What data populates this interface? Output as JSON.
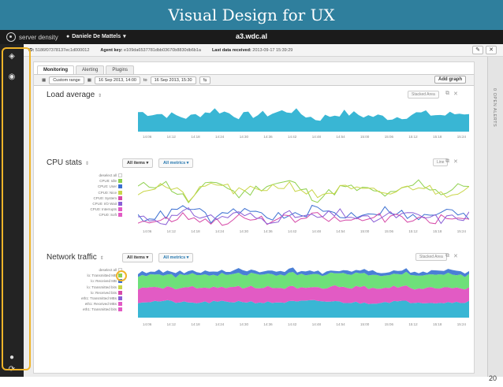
{
  "slide": {
    "title": "Visual Design for UX",
    "page_number": "20"
  },
  "colors": {
    "banner": "#2f7f9d",
    "highlight": "#f0b429",
    "chart_blue": "#39b6d4"
  },
  "app": {
    "logo_text": "server density",
    "user_name": "Daniele De Mattels",
    "host": "a3.wdc.al",
    "info": {
      "id_label": "ID:",
      "id_value": "5186f07378137ec1d000012",
      "agent_label": "Agent key:",
      "agent_value": "e109da6537781dbb03670b8830db6b1a",
      "last_label": "Last data received:",
      "last_value": "2013-09-17 15:39:29"
    },
    "tools": {
      "edit": "✎",
      "close": "✕"
    },
    "sidebar_icons": [
      "layers-icon",
      "globe-icon",
      "chat-icon",
      "settings-icon"
    ]
  },
  "tabs": [
    {
      "label": "Monitoring"
    },
    {
      "label": "Alerting"
    },
    {
      "label": "Plugins"
    }
  ],
  "controls": {
    "range": "Custom range",
    "from": "16 Sep 2013, 14:00",
    "to_label": "to",
    "to": "16 Sep 2013, 15:30",
    "add_graph": "Add graph"
  },
  "alerts": {
    "label": "0 OPEN ALERTS"
  },
  "xticks": [
    "14:06",
    "14:12",
    "14:18",
    "14:24",
    "14:30",
    "14:36",
    "14:42",
    "14:48",
    "14:54",
    "15:00",
    "15:06",
    "15:12",
    "15:18",
    "15:24"
  ],
  "sections": {
    "load": {
      "title": "Load average",
      "type": "Stacked Area"
    },
    "cpu": {
      "title": "CPU stats",
      "items": "All items",
      "metrics": "All metrics",
      "type": "Line",
      "legend": [
        "deselect all",
        "CPU0: Idle",
        "CPU0: User",
        "CPU0: Nice",
        "CPU0: System",
        "CPU0: I/O Wait",
        "CPU0: Interrupts",
        "CPU0: Soft"
      ]
    },
    "net": {
      "title": "Network traffic",
      "items": "All items",
      "metrics": "All metrics",
      "type": "Stacked Area",
      "legend": [
        "deselect all",
        "lo: Transmitted MB",
        "lo: Received MB",
        "lo: Transmitted bits",
        "lo: Received bits",
        "eth1: Transmitted MBs",
        "eth1: Received MBs",
        "eth1: Transmitted bits"
      ]
    }
  },
  "chart_data": [
    {
      "type": "area",
      "title": "Load average",
      "x": [
        "14:06",
        "14:12",
        "14:18",
        "14:24",
        "14:30",
        "14:36",
        "14:42",
        "14:48",
        "14:54",
        "15:00",
        "15:06",
        "15:12",
        "15:18",
        "15:24"
      ],
      "series": [
        {
          "values": [
            0.62,
            0.55,
            0.45,
            0.7,
            0.5,
            0.55,
            0.68,
            0.4,
            0.6,
            0.5,
            0.45,
            0.58,
            0.52,
            0.62
          ]
        }
      ],
      "color": "#39b6d4"
    },
    {
      "type": "line",
      "title": "CPU stats",
      "x": [
        "14:06",
        "14:12",
        "14:18",
        "14:24",
        "14:30",
        "14:36",
        "14:42",
        "14:48",
        "14:54",
        "15:00",
        "15:06",
        "15:12",
        "15:18",
        "15:24"
      ],
      "series": [
        {
          "name": "CPU0: Idle",
          "color": "#8fd14f",
          "values": [
            0.7,
            0.8,
            0.45,
            0.85,
            0.55,
            0.75,
            0.8,
            0.5,
            0.7,
            0.65,
            0.55,
            0.8,
            0.6,
            0.78
          ]
        },
        {
          "name": "CPU0: User",
          "color": "#3b6fd1",
          "values": [
            0.15,
            0.2,
            0.35,
            0.1,
            0.3,
            0.2,
            0.15,
            0.32,
            0.18,
            0.25,
            0.3,
            0.12,
            0.28,
            0.15
          ]
        },
        {
          "name": "CPU0: Nice",
          "color": "#c9d64a",
          "values": [
            0.65,
            0.75,
            0.5,
            0.8,
            0.6,
            0.7,
            0.75,
            0.55,
            0.68,
            0.62,
            0.6,
            0.75,
            0.58,
            0.72
          ]
        },
        {
          "name": "CPU0: System",
          "color": "#d64aa8",
          "values": [
            0.1,
            0.12,
            0.2,
            0.08,
            0.15,
            0.1,
            0.12,
            0.18,
            0.1,
            0.14,
            0.16,
            0.08,
            0.15,
            0.1
          ]
        },
        {
          "name": "CPU0: I/O Wait",
          "color": "#8a5fd6",
          "values": [
            0.18,
            0.1,
            0.25,
            0.15,
            0.22,
            0.12,
            0.2,
            0.15,
            0.24,
            0.1,
            0.2,
            0.18,
            0.12,
            0.2
          ]
        }
      ]
    },
    {
      "type": "area",
      "title": "Network traffic",
      "x": [
        "14:06",
        "14:12",
        "14:18",
        "14:24",
        "14:30",
        "14:36",
        "14:42",
        "14:48",
        "14:54",
        "15:00",
        "15:06",
        "15:12",
        "15:18",
        "15:24"
      ],
      "series": [
        {
          "name": "eth1: Transmitted bits",
          "color": "#39b6d4",
          "values": [
            0.3,
            0.32,
            0.28,
            0.3,
            0.31,
            0.29,
            0.3,
            0.32,
            0.3,
            0.28,
            0.31,
            0.3,
            0.29,
            0.31
          ]
        },
        {
          "name": "eth1: Received MBs",
          "color": "#e25bc4",
          "values": [
            0.28,
            0.26,
            0.3,
            0.27,
            0.28,
            0.3,
            0.27,
            0.26,
            0.29,
            0.3,
            0.27,
            0.28,
            0.3,
            0.27
          ]
        },
        {
          "name": "lo: Transmitted MB",
          "color": "#6ee07a",
          "values": [
            0.25,
            0.24,
            0.26,
            0.25,
            0.24,
            0.26,
            0.25,
            0.24,
            0.25,
            0.26,
            0.24,
            0.25,
            0.26,
            0.24
          ]
        },
        {
          "name": "lo: Received MB",
          "color": "#4a7fd6",
          "values": [
            0.06,
            0.07,
            0.05,
            0.06,
            0.08,
            0.05,
            0.07,
            0.06,
            0.05,
            0.07,
            0.06,
            0.05,
            0.07,
            0.06
          ]
        }
      ]
    }
  ]
}
